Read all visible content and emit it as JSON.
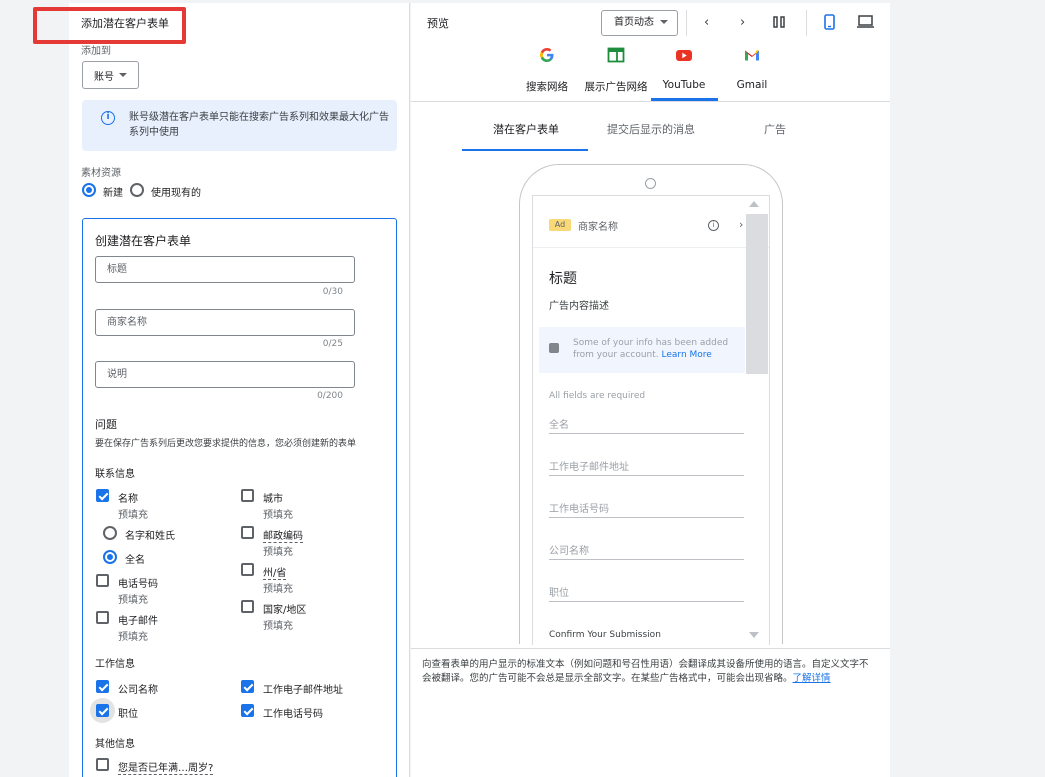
{
  "left": {
    "title": "添加潜在客户表单",
    "add_to_label": "添加到",
    "add_to_value": "账号",
    "info": "账号级潜在客户表单只能在搜索广告系列和效果最大化广告系列中使用",
    "asset_source_label": "素材资源",
    "radio_new": "新建",
    "radio_existing": "使用现有的",
    "form": {
      "title": "创建潜在客户表单",
      "headline_placeholder": "标题",
      "headline_count": "0/30",
      "business_placeholder": "商家名称",
      "business_count": "0/25",
      "desc_placeholder": "说明",
      "desc_count": "0/200",
      "questions_label": "问题",
      "questions_note": "要在保存广告系列后更改您要求提供的信息，您必须创建新的表单",
      "contact_label": "联系信息",
      "name": "名称",
      "prefill": "预填充",
      "first_last": "名字和姓氏",
      "full_name": "全名",
      "phone": "电话号码",
      "email": "电子邮件",
      "city": "城市",
      "zip": "邮政编码",
      "state": "州/省",
      "country": "国家/地区",
      "work_label": "工作信息",
      "company": "公司名称",
      "job_title": "职位",
      "work_email": "工作电子邮件地址",
      "work_phone": "工作电话号码",
      "other_label": "其他信息",
      "other_q": "您是否已年满…周岁?"
    }
  },
  "right": {
    "preview_label": "预览",
    "page_select": "首页动态",
    "channels": [
      "搜索网络",
      "展示广告网络",
      "YouTube",
      "Gmail"
    ],
    "tabs": [
      "潜在客户表单",
      "提交后显示的消息",
      "广告"
    ],
    "phone": {
      "ad_badge": "Ad",
      "business": "商家名称",
      "headline": "标题",
      "description": "广告内容描述",
      "notice": "Some of your info has been added from your account.",
      "learn_more": "Learn More",
      "required": "All fields are required",
      "fields": [
        "全名",
        "工作电子邮件地址",
        "工作电话号码",
        "公司名称",
        "职位"
      ],
      "confirm": "Confirm Your Submission"
    },
    "note": "向查看表单的用户显示的标准文本（例如问题和号召性用语）会翻译成其设备所使用的语言。自定义文字不会被翻译。您的广告可能不会总是显示全部文字。在某些广告格式中，可能会出现省略。",
    "note_link": "了解详情"
  }
}
